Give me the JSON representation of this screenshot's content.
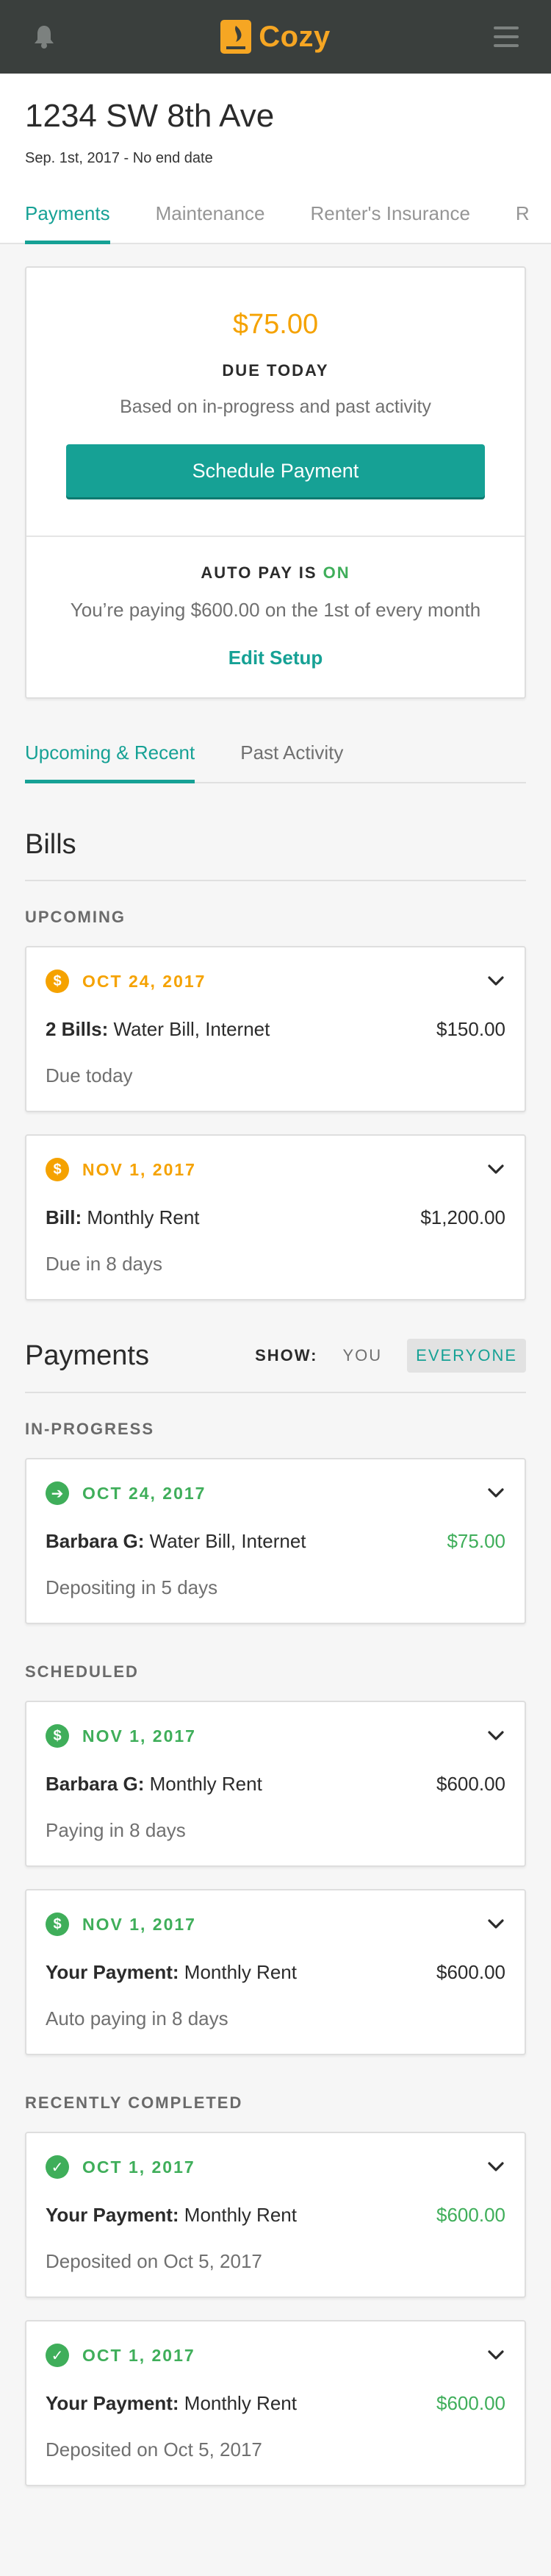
{
  "app": {
    "logo_text": "Cozy"
  },
  "property": {
    "address": "1234 SW 8th Ave",
    "dates": "Sep. 1st, 2017 - No end date"
  },
  "tabs": [
    {
      "label": "Payments"
    },
    {
      "label": "Maintenance"
    },
    {
      "label": "Renter's Insurance"
    },
    {
      "label": "R"
    }
  ],
  "summary": {
    "amount": "$75.00",
    "due_label": "DUE TODAY",
    "based_on": "Based on in-progress and past activity",
    "button": "Schedule Payment",
    "autopay_prefix": "AUTO PAY IS ",
    "autopay_state": "ON",
    "autopay_desc": "You’re paying $600.00 on the 1st of every month",
    "edit": "Edit Setup"
  },
  "subtabs": [
    {
      "label": "Upcoming & Recent"
    },
    {
      "label": "Past Activity"
    }
  ],
  "bills": {
    "title": "Bills",
    "upcoming_label": "UPCOMING",
    "items": [
      {
        "date": "OCT 24, 2017",
        "icon": "$",
        "label": "2 Bills:",
        "text": " Water Bill, Internet",
        "amount": "$150.00",
        "status": "Due today"
      },
      {
        "date": "NOV 1, 2017",
        "icon": "$",
        "label": "Bill:",
        "text": " Monthly Rent",
        "amount": "$1,200.00",
        "status": "Due in 8 days"
      }
    ]
  },
  "payments": {
    "title": "Payments",
    "show_label": "SHOW:",
    "show_you": "YOU",
    "show_everyone": "EVERYONE",
    "inprogress_label": "IN-PROGRESS",
    "inprogress": [
      {
        "date": "OCT 24, 2017",
        "icon": "➔",
        "label": "Barbara G:",
        "text": " Water Bill, Internet",
        "amount": "$75.00",
        "status": "Depositing in 5 days"
      }
    ],
    "scheduled_label": "SCHEDULED",
    "scheduled": [
      {
        "date": "NOV 1, 2017",
        "icon": "$",
        "label": "Barbara G:",
        "text": " Monthly Rent",
        "amount": "$600.00",
        "status": "Paying in 8 days"
      },
      {
        "date": "NOV 1, 2017",
        "icon": "$",
        "label": "Your Payment:",
        "text": " Monthly Rent",
        "amount": "$600.00",
        "status": "Auto paying in 8 days"
      }
    ],
    "completed_label": "RECENTLY COMPLETED",
    "completed": [
      {
        "date": "OCT 1, 2017",
        "icon": "✓",
        "label": "Your Payment:",
        "text": " Monthly Rent",
        "amount": "$600.00",
        "status": "Deposited on Oct 5, 2017"
      },
      {
        "date": "OCT 1, 2017",
        "icon": "✓",
        "label": "Your Payment:",
        "text": " Monthly Rent",
        "amount": "$600.00",
        "status": "Deposited on Oct 5, 2017"
      }
    ]
  },
  "colors": {
    "teal": "#16a195",
    "orange": "#f5a200",
    "green": "#3fae5a",
    "topbar": "#3a3f3d"
  },
  "icons": {
    "bell": "bell-icon",
    "logo": "cozy-logo-icon",
    "menu": "hamburger-menu-icon",
    "chevron": "chevron-down-icon"
  }
}
